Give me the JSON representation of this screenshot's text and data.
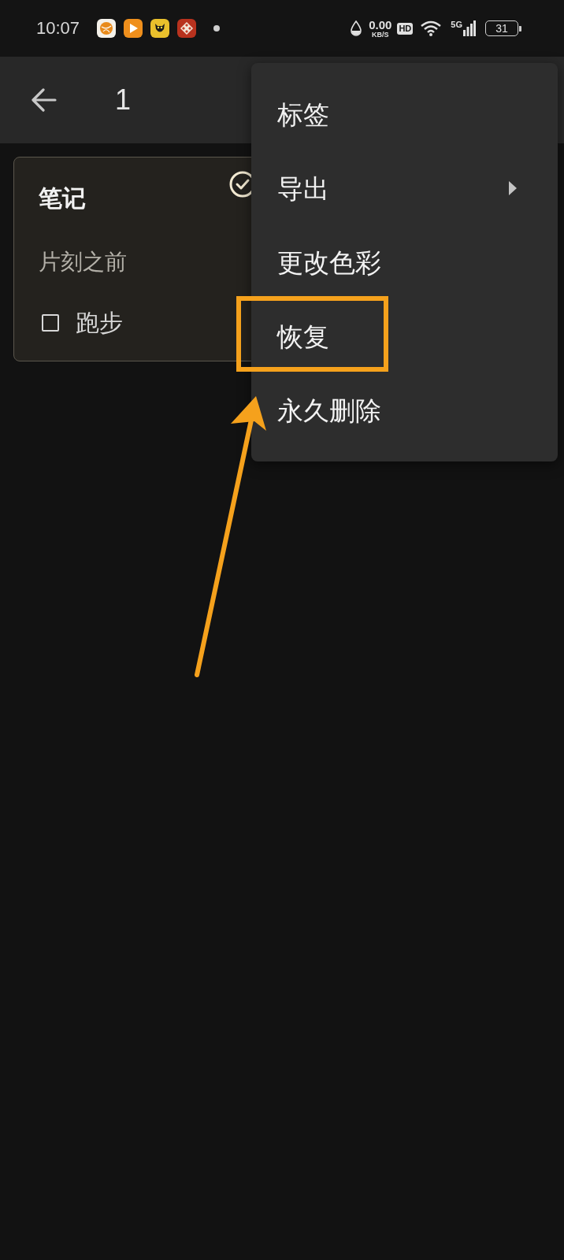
{
  "status_bar": {
    "time": "10:07",
    "speed": "0.00",
    "speed_unit": "KB/S",
    "hd": "HD",
    "network": "5G",
    "battery": "31"
  },
  "app_bar": {
    "title": "1"
  },
  "notes": [
    {
      "title": "笔记",
      "time": "片刻之前",
      "selected": true,
      "checklist": [
        {
          "text": "跑步",
          "checked": false
        }
      ]
    }
  ],
  "menu": {
    "items": [
      {
        "label": "标签",
        "has_submenu": false,
        "annotated": false
      },
      {
        "label": "导出",
        "has_submenu": true,
        "annotated": false
      },
      {
        "label": "更改色彩",
        "has_submenu": false,
        "annotated": false
      },
      {
        "label": "恢复",
        "has_submenu": false,
        "annotated": true
      },
      {
        "label": "永久删除",
        "has_submenu": false,
        "annotated": false
      }
    ]
  }
}
